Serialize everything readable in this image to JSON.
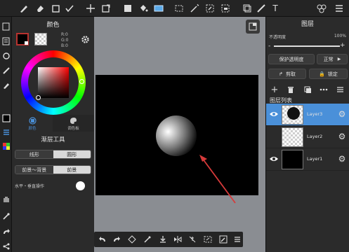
{
  "colors": {
    "accent": "#2f7fd0",
    "panel": "#2b2b2b",
    "toolbar": "#242424",
    "workspace": "#8a8d92",
    "canvas": "#000000",
    "arrow": "#d63a3a"
  },
  "top_toolbar": {
    "icons": [
      "brush-icon",
      "eraser-icon",
      "smudge-icon",
      "select-rect-icon",
      "check-icon",
      "move-icon",
      "transform-icon",
      "fill-color-icon",
      "bucket-icon",
      "gradient-icon",
      "lasso-select-icon",
      "magic-wand-icon",
      "select-pen-icon",
      "select-eraser-icon",
      "text-tool-icon",
      "layer-panel-icon",
      "menu-icon"
    ]
  },
  "color_panel": {
    "title": "颜色",
    "rgb": {
      "r": "R:0",
      "g": "G:0",
      "b": "B:0"
    },
    "tabs": [
      {
        "label": "颜色"
      },
      {
        "label": "调色板"
      }
    ]
  },
  "gradient_tool": {
    "title": "渐层工具",
    "shape": {
      "linear": "线形",
      "circular": "圆形"
    },
    "mode": {
      "fg_bg": "前景～背景",
      "fg": "前景"
    },
    "option_label": "水平・垂直操作"
  },
  "layer_panel": {
    "title": "图层",
    "opacity_label": "不透明度",
    "opacity_value": "100%",
    "protect_alpha": "保护透明度",
    "blend_mode": "正常",
    "clip": "剪取",
    "lock": "锁定",
    "list_title": "图层列表",
    "layers": [
      {
        "name": "Layer3",
        "visible": true,
        "selected": true
      },
      {
        "name": "Layer2",
        "visible": false,
        "selected": false
      },
      {
        "name": "Layer1",
        "visible": true,
        "selected": false
      }
    ]
  }
}
